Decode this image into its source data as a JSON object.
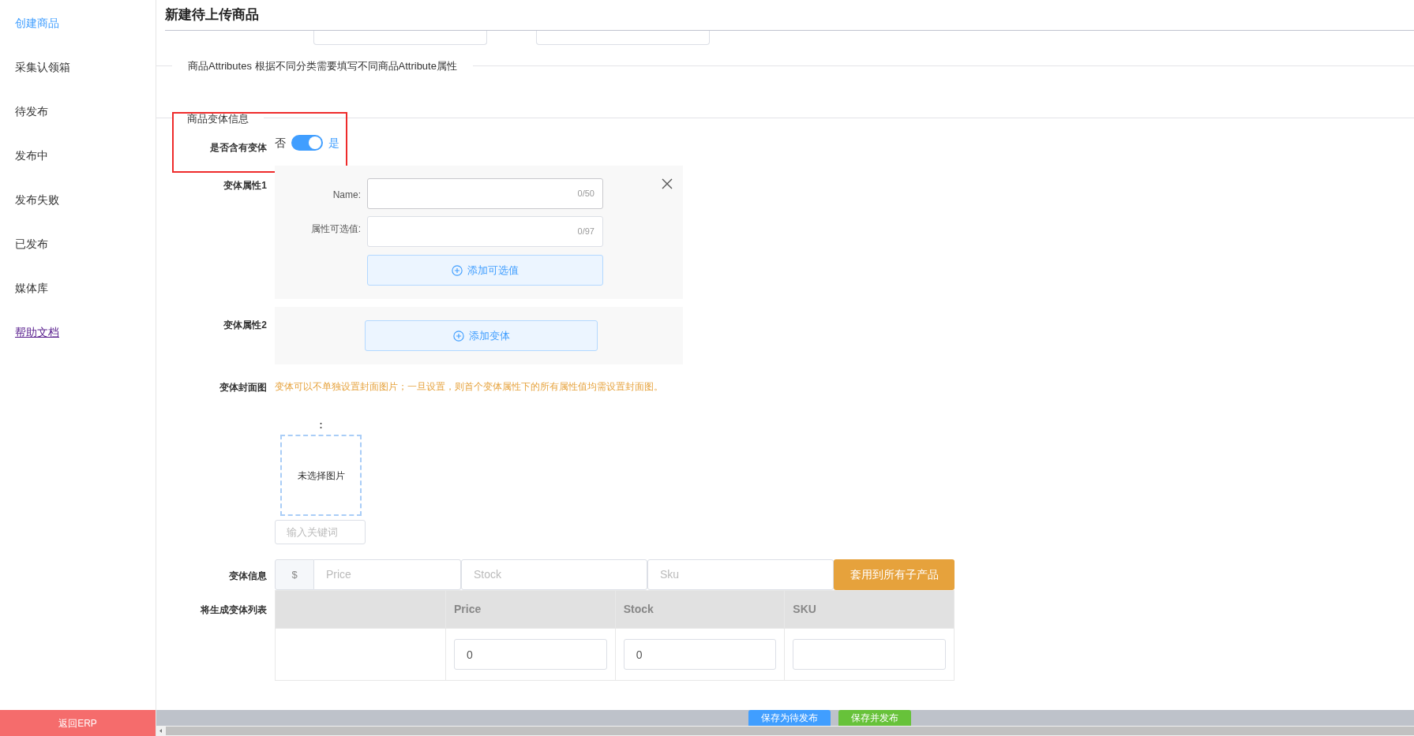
{
  "sidebar": {
    "items": [
      {
        "label": "创建商品",
        "kind": "nav",
        "selected": true
      },
      {
        "label": "采集认领箱",
        "kind": "nav",
        "selected": false
      },
      {
        "label": "待发布",
        "kind": "nav",
        "selected": false
      },
      {
        "label": "发布中",
        "kind": "nav",
        "selected": false
      },
      {
        "label": "发布失败",
        "kind": "nav",
        "selected": false
      },
      {
        "label": "已发布",
        "kind": "nav",
        "selected": false
      },
      {
        "label": "媒体库",
        "kind": "nav",
        "selected": false
      },
      {
        "label": "帮助文档",
        "kind": "link",
        "selected": false
      }
    ],
    "footer_button": "返回ERP"
  },
  "header": {
    "title": "新建待上传商品"
  },
  "attributes_section": {
    "legend": "商品Attributes 根据不同分类需要填写不同商品Attribute属性"
  },
  "variant_section": {
    "legend": "商品变体信息",
    "has_variants": {
      "label": "是否含有变体",
      "off_label": "否",
      "on_label": "是",
      "on": true
    }
  },
  "variant_attributes": [
    {
      "label": "变体属性1",
      "kind": "form",
      "name_label": "Name:",
      "name_counter": "0/50",
      "values_label": "属性可选值:",
      "values_counter": "0/97",
      "add_button": "添加可选值"
    },
    {
      "label": "变体属性2",
      "kind": "add",
      "add_button": "添加变体"
    }
  ],
  "cover": {
    "label": "变体封面图",
    "hint": "变体可以不单独设置封面图片；一旦设置，则首个变体属性下的所有属性值均需设置封面图。",
    "colon": ":",
    "image_placeholder": "未选择图片",
    "keyword_placeholder": "输入关键词"
  },
  "variant_info": {
    "label": "变体信息",
    "currency": "$",
    "price_placeholder": "Price",
    "stock_placeholder": "Stock",
    "sku_placeholder": "Sku",
    "apply_button": "套用到所有子产品"
  },
  "variant_list": {
    "label": "将生成变体列表",
    "columns": [
      "Price",
      "Stock",
      "SKU"
    ],
    "rows": [
      {
        "price": "0",
        "stock": "0"
      }
    ]
  },
  "footer": {
    "buttons": [
      {
        "label": "保存为待发布",
        "kind": "primary"
      },
      {
        "label": "保存并发布",
        "kind": "success"
      }
    ]
  }
}
